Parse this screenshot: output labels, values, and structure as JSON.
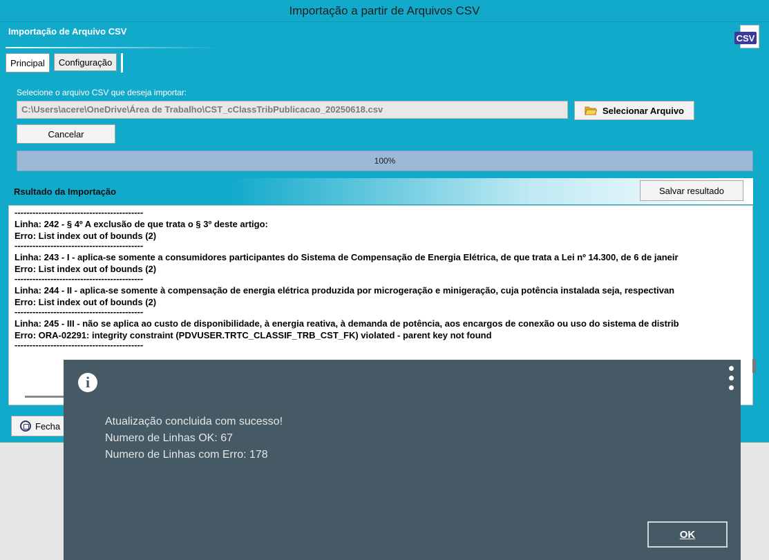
{
  "window": {
    "title": "Importação a partir de Arquivos CSV"
  },
  "header": {
    "title": "Importação de Arquivo CSV",
    "icon_label": "CSV",
    "icon": "csv-file-icon"
  },
  "tabs": [
    {
      "label": "Principal",
      "active": true
    },
    {
      "label": "Configuração",
      "active": false
    }
  ],
  "file_select": {
    "label": "Selecione o arquivo CSV que deseja importar:",
    "path": "C:\\Users\\acere\\OneDrive\\Área de Trabalho\\CST_cClassTribPublicacao_20250618.csv",
    "button_label": "Selecionar Arquivo",
    "button_icon": "folder-open-icon"
  },
  "cancel_label": "Cancelar",
  "progress": {
    "percent": 100,
    "text": "100%"
  },
  "result": {
    "title": "Rsultado da Importação",
    "save_label": "Salvar resultado",
    "separator": "-------------------------------------------",
    "entries": [
      {
        "line": "Linha: 242 - § 4º A exclusão de que trata o § 3º deste artigo:",
        "error": "Erro: List index out of bounds (2)"
      },
      {
        "line": "Linha: 243 - I - aplica-se somente a consumidores participantes do Sistema de Compensação de Energia Elétrica, de que trata a Lei nº 14.300, de 6 de janeir",
        "error": "Erro: List index out of bounds (2)"
      },
      {
        "line": "Linha: 244 - II - aplica-se somente à compensação de energia elétrica produzida por microgeração e minigeração, cuja potência instalada seja, respectivan",
        "error": "Erro: List index out of bounds (2)"
      },
      {
        "line": "Linha: 245 - III - não se aplica ao custo de disponibilidade, à energia reativa, à demanda de potência, aos encargos de conexão ou uso do sistema de distrib",
        "error": "Erro: ORA-02291: integrity constraint (PDVUSER.TRTC_CLASSIF_TRB_CST_FK) violated - parent key not found"
      }
    ]
  },
  "close_label": "Fecha",
  "dialog": {
    "icon": "info-icon",
    "menu_icon": "kebab-menu-icon",
    "lines": [
      "Atualização concluida com sucesso!",
      "Numero de Linhas OK: 67",
      "Numero de Linhas com Erro: 178"
    ],
    "ok_label": "OK",
    "bg_color": "#455a64"
  }
}
